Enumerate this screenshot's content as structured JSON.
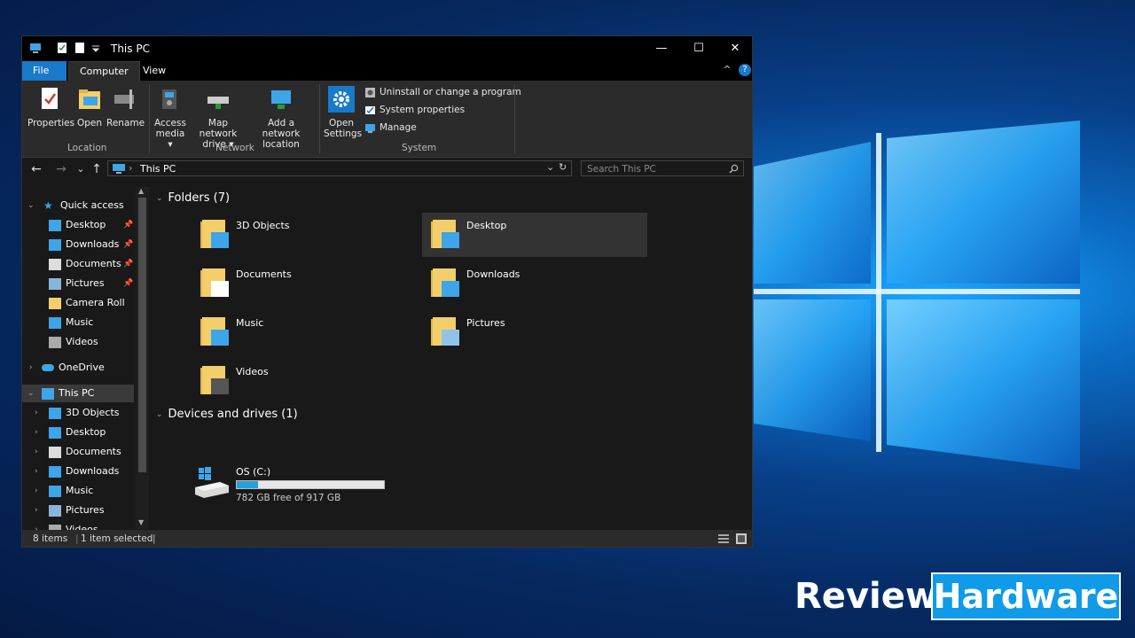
{
  "window": {
    "title": "This PC",
    "minimize": "—",
    "maximize": "☐",
    "close": "✕"
  },
  "tabs": {
    "file": "File",
    "computer": "Computer",
    "view": "View",
    "collapse": "^",
    "help": "?"
  },
  "ribbon": {
    "location": {
      "label": "Location",
      "properties": "Properties",
      "open": "Open",
      "rename": "Rename"
    },
    "network": {
      "label": "Network",
      "access_media_1": "Access",
      "access_media_2": "media ▾",
      "map_drive_1": "Map network",
      "map_drive_2": "drive ▾",
      "add_location_1": "Add a network",
      "add_location_2": "location"
    },
    "system": {
      "label": "System",
      "open_settings_1": "Open",
      "open_settings_2": "Settings",
      "uninstall": "Uninstall or change a program",
      "system_properties": "System properties",
      "manage": "Manage"
    }
  },
  "address": {
    "back": "←",
    "forward": "→",
    "recent": "⌄",
    "up": "↑",
    "crumb": "This PC",
    "dropdown": "⌄",
    "refresh": "↻",
    "search_placeholder": "Search This PC",
    "search_icon": "search-icon"
  },
  "nav": {
    "quick_access": "Quick access",
    "quick_items": [
      {
        "label": "Desktop",
        "pinned": true
      },
      {
        "label": "Downloads",
        "pinned": true
      },
      {
        "label": "Documents",
        "pinned": true
      },
      {
        "label": "Pictures",
        "pinned": true
      },
      {
        "label": "Camera Roll",
        "pinned": false
      },
      {
        "label": "Music",
        "pinned": false
      },
      {
        "label": "Videos",
        "pinned": false
      }
    ],
    "onedrive": "OneDrive",
    "this_pc": "This PC",
    "pc_items": [
      "3D Objects",
      "Desktop",
      "Documents",
      "Downloads",
      "Music",
      "Pictures",
      "Videos"
    ]
  },
  "content": {
    "folders_header": "Folders (7)",
    "folders": [
      "3D Objects",
      "Desktop",
      "Documents",
      "Downloads",
      "Music",
      "Pictures",
      "Videos"
    ],
    "devices_header": "Devices and drives (1)",
    "drive": {
      "name": "OS (C:)",
      "free_text": "782 GB free of 917 GB",
      "used_fraction": 0.147
    }
  },
  "status": {
    "items": "8 items",
    "selected": "1 item selected"
  },
  "watermark": {
    "word1": "Review",
    "word2": "Hardware"
  },
  "colors": {
    "accent": "#1979ca",
    "drive_fill": "#26a0da",
    "folder_yellow": "#f3cf6b",
    "background_dark": "#191919"
  }
}
